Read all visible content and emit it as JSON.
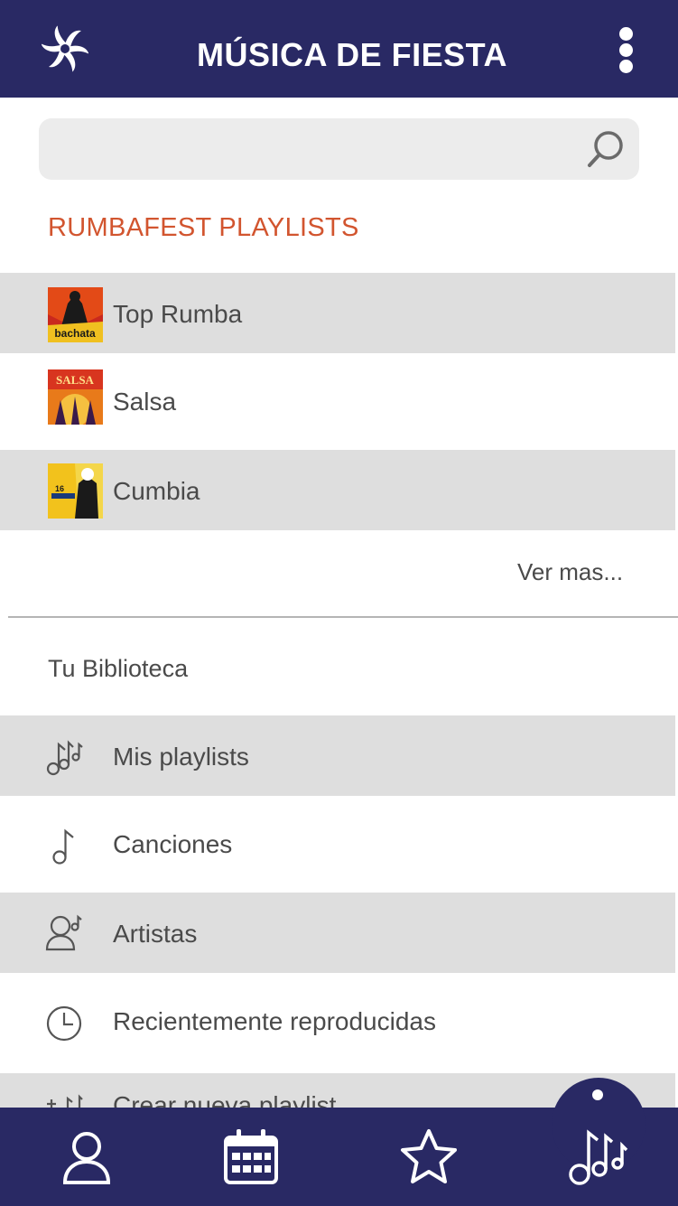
{
  "header": {
    "title": "MÚSICA DE FIESTA",
    "logo_icon": "pinwheel-logo-icon",
    "menu_icon": "more-vertical-icon"
  },
  "search": {
    "value": "",
    "placeholder": "",
    "icon": "search-icon"
  },
  "playlists": {
    "heading": "RUMBAFEST PLAYLISTS",
    "items": [
      {
        "label": "Top Rumba",
        "cover_text": "bachata"
      },
      {
        "label": "Salsa",
        "cover_text": "SALSA"
      },
      {
        "label": "Cumbia",
        "cover_text": "16"
      }
    ],
    "more_label": "Ver mas..."
  },
  "library": {
    "heading": "Tu Biblioteca",
    "items": [
      {
        "label": "Mis playlists",
        "icon": "music-notes-icon"
      },
      {
        "label": "Canciones",
        "icon": "music-note-icon"
      },
      {
        "label": "Artistas",
        "icon": "artist-icon"
      },
      {
        "label": "Recientemente reproducidas",
        "icon": "clock-icon"
      },
      {
        "label": "Crear nueva playlist",
        "icon": "add-playlist-icon"
      }
    ]
  },
  "bottom_nav": {
    "items": [
      {
        "icon": "profile-icon"
      },
      {
        "icon": "calendar-icon"
      },
      {
        "icon": "star-icon"
      },
      {
        "icon": "music-library-icon"
      }
    ]
  },
  "colors": {
    "primary": "#292964",
    "accent": "#d2552f",
    "row_grey": "#dedede",
    "search_bg": "#ececec",
    "text": "#4a4a4a"
  }
}
